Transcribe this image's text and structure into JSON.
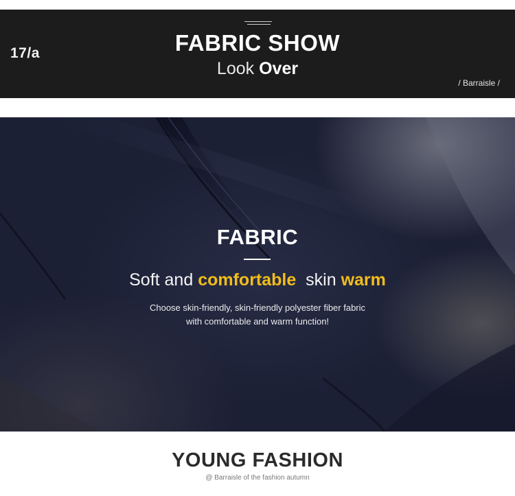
{
  "header": {
    "issue_label": "17/a",
    "title": "FABRIC SHOW",
    "subtitle_light": "Look",
    "subtitle_bold": "Over",
    "brand_tag": "/ Barraisle /"
  },
  "fabric_section": {
    "heading": "FABRIC",
    "tagline": {
      "part1": "Soft and ",
      "part2": "comfortable",
      "part3": "  skin ",
      "part4": "warm"
    },
    "description_line1": "Choose skin-friendly, skin-friendly polyester fiber fabric",
    "description_line2": "with comfortable and warm function!",
    "accent_color": "#f2bd1c"
  },
  "footer": {
    "title": "YOUNG FASHION",
    "subtitle": "@ Barraisle of the fashion autumn"
  }
}
